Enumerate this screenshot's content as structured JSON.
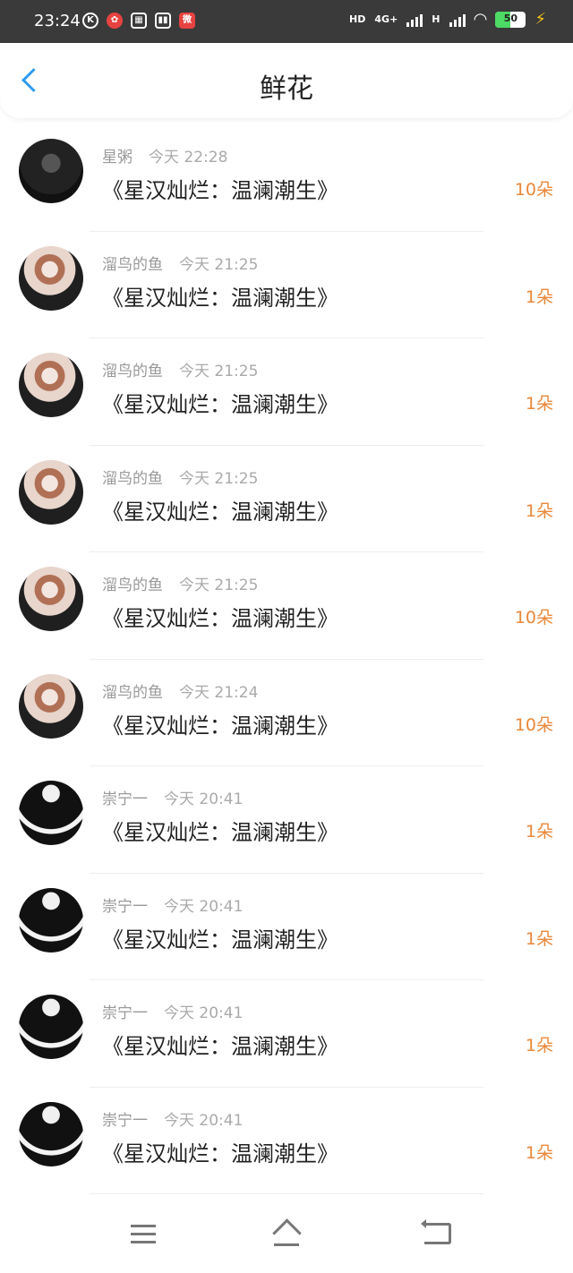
{
  "status_bar": {
    "time": "23:24",
    "apps": [
      "K",
      "✿",
      "▦",
      "▮▮",
      "微"
    ],
    "hd": "HD",
    "network_4g": "4G+",
    "network_h": "H",
    "battery": "50",
    "battery_level": 0.5
  },
  "header": {
    "back_icon": "chevron-left-icon",
    "title": "鲜花"
  },
  "records": [
    {
      "user": "星粥",
      "time": "今天 22:28",
      "book": "《星汉灿烂：温澜潮生》",
      "count": "10朵",
      "avatar": "dark"
    },
    {
      "user": "溜鸟的鱼",
      "time": "今天 21:25",
      "book": "《星汉灿烂：温澜潮生》",
      "count": "1朵",
      "avatar": "face"
    },
    {
      "user": "溜鸟的鱼",
      "time": "今天 21:25",
      "book": "《星汉灿烂：温澜潮生》",
      "count": "1朵",
      "avatar": "face"
    },
    {
      "user": "溜鸟的鱼",
      "time": "今天 21:25",
      "book": "《星汉灿烂：温澜潮生》",
      "count": "1朵",
      "avatar": "face"
    },
    {
      "user": "溜鸟的鱼",
      "time": "今天 21:25",
      "book": "《星汉灿烂：温澜潮生》",
      "count": "10朵",
      "avatar": "face"
    },
    {
      "user": "溜鸟的鱼",
      "time": "今天 21:24",
      "book": "《星汉灿烂：温澜潮生》",
      "count": "10朵",
      "avatar": "face"
    },
    {
      "user": "崇宁一",
      "time": "今天 20:41",
      "book": "《星汉灿烂：温澜潮生》",
      "count": "1朵",
      "avatar": "robe"
    },
    {
      "user": "崇宁一",
      "time": "今天 20:41",
      "book": "《星汉灿烂：温澜潮生》",
      "count": "1朵",
      "avatar": "robe"
    },
    {
      "user": "崇宁一",
      "time": "今天 20:41",
      "book": "《星汉灿烂：温澜潮生》",
      "count": "1朵",
      "avatar": "robe"
    },
    {
      "user": "崇宁一",
      "time": "今天 20:41",
      "book": "《星汉灿烂：温澜潮生》",
      "count": "1朵",
      "avatar": "robe"
    }
  ],
  "nav": {
    "menu_icon": "menu-icon",
    "home_icon": "home-icon",
    "back_icon": "back-icon"
  },
  "colors": {
    "accent": "#2f9bef",
    "count": "#e8883a",
    "status_bar": "#3a3a3a"
  }
}
